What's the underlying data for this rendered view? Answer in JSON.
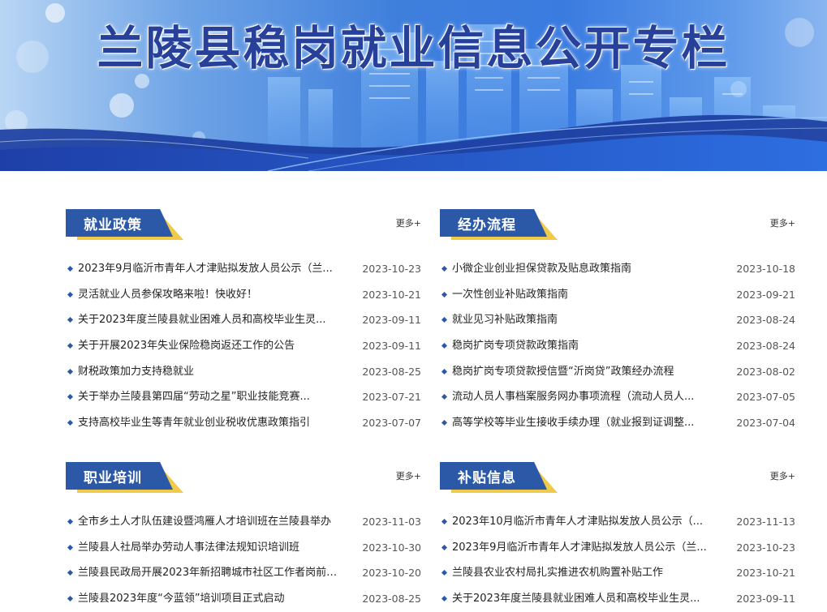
{
  "banner": {
    "title": "兰陵县稳岗就业信息公开专栏"
  },
  "colors": {
    "accent": "#2b59a8",
    "highlight": "#f0cb4b"
  },
  "sections": [
    {
      "title": "就业政策",
      "more": "更多+",
      "items": [
        {
          "title": "2023年9月临沂市青年人才津贴拟发放人员公示（兰...",
          "date": "2023-10-23"
        },
        {
          "title": "灵活就业人员参保攻略来啦！快收好！",
          "date": "2023-10-21"
        },
        {
          "title": "关于2023年度兰陵县就业困难人员和高校毕业生灵...",
          "date": "2023-09-11"
        },
        {
          "title": "关于开展2023年失业保险稳岗返还工作的公告",
          "date": "2023-09-11"
        },
        {
          "title": "财税政策加力支持稳就业",
          "date": "2023-08-25"
        },
        {
          "title": "关于举办兰陵县第四届“劳动之星”职业技能竞赛...",
          "date": "2023-07-21"
        },
        {
          "title": "支持高校毕业生等青年就业创业税收优惠政策指引",
          "date": "2023-07-07"
        }
      ]
    },
    {
      "title": "经办流程",
      "more": "更多+",
      "items": [
        {
          "title": "小微企业创业担保贷款及贴息政策指南",
          "date": "2023-10-18"
        },
        {
          "title": "一次性创业补贴政策指南",
          "date": "2023-09-21"
        },
        {
          "title": "就业见习补贴政策指南",
          "date": "2023-08-24"
        },
        {
          "title": "稳岗扩岗专项贷款政策指南",
          "date": "2023-08-24"
        },
        {
          "title": "稳岗扩岗专项贷款授信暨“沂岗贷”政策经办流程",
          "date": "2023-08-02"
        },
        {
          "title": "流动人员人事档案服务网办事项流程（流动人员人...",
          "date": "2023-07-05"
        },
        {
          "title": "高等学校等毕业生接收手续办理（就业报到证调整...",
          "date": "2023-07-04"
        }
      ]
    },
    {
      "title": "职业培训",
      "more": "更多+",
      "items": [
        {
          "title": "全市乡土人才队伍建设暨鸿雁人才培训班在兰陵县举办",
          "date": "2023-11-03"
        },
        {
          "title": "兰陵县人社局举办劳动人事法律法规知识培训班",
          "date": "2023-10-30"
        },
        {
          "title": "兰陵县民政局开展2023年新招聘城市社区工作者岗前培训",
          "date": "2023-10-20"
        },
        {
          "title": "兰陵县2023年度“今蓝领”培训项目正式启动",
          "date": "2023-08-25"
        }
      ]
    },
    {
      "title": "补贴信息",
      "more": "更多+",
      "items": [
        {
          "title": "2023年10月临沂市青年人才津贴拟发放人员公示（...",
          "date": "2023-11-13"
        },
        {
          "title": "2023年9月临沂市青年人才津贴拟发放人员公示（兰...",
          "date": "2023-10-23"
        },
        {
          "title": "兰陵县农业农村局扎实推进农机购置补贴工作",
          "date": "2023-10-21"
        },
        {
          "title": "关于2023年度兰陵县就业困难人员和高校毕业生灵...",
          "date": "2023-09-11"
        }
      ]
    }
  ]
}
